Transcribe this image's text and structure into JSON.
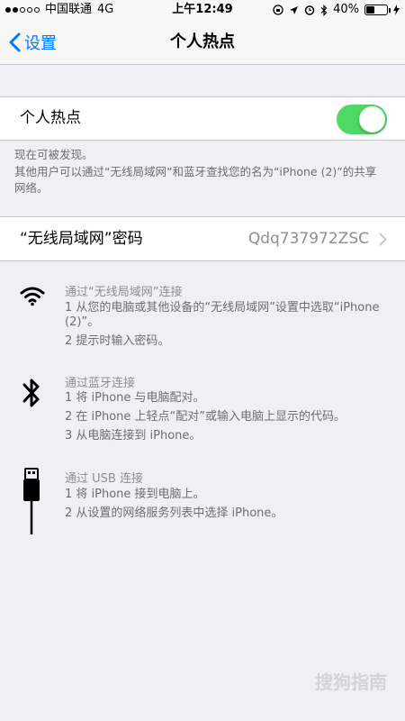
{
  "status_bar": {
    "carrier": "中国联通",
    "network": "4G",
    "time": "上午12:49",
    "battery_text": "40%",
    "battery_level": 0.4
  },
  "nav": {
    "back_label": "设置",
    "title": "个人热点"
  },
  "hotspot": {
    "label": "个人热点",
    "toggle_on": true,
    "toggle_color": "#4cd964"
  },
  "discoverable": {
    "line1": "现在可被发现。",
    "line2": "其他用户可以通过“无线局域网”和蓝牙查找您的名为“iPhone (2)”的共享网络。"
  },
  "password": {
    "label": "“无线局域网”密码",
    "value": "Qdq737972ZSC"
  },
  "instructions": {
    "wifi": {
      "title": "通过“无线局域网”连接",
      "step1": "1 从您的电脑或其他设备的“无线局域网”设置中选取“iPhone (2)”。",
      "step2": "2 提示时输入密码。"
    },
    "bluetooth": {
      "title": "通过蓝牙连接",
      "step1": "1 将 iPhone 与电脑配对。",
      "step2": "2 在 iPhone 上轻点“配对”或输入电脑上显示的代码。",
      "step3": "3 从电脑连接到 iPhone。"
    },
    "usb": {
      "title": "通过 USB 连接",
      "step1": "1 将 iPhone 接到电脑上。",
      "step2": "2 从设置的网络服务列表中选择 iPhone。"
    }
  },
  "watermark": "搜狗指南"
}
